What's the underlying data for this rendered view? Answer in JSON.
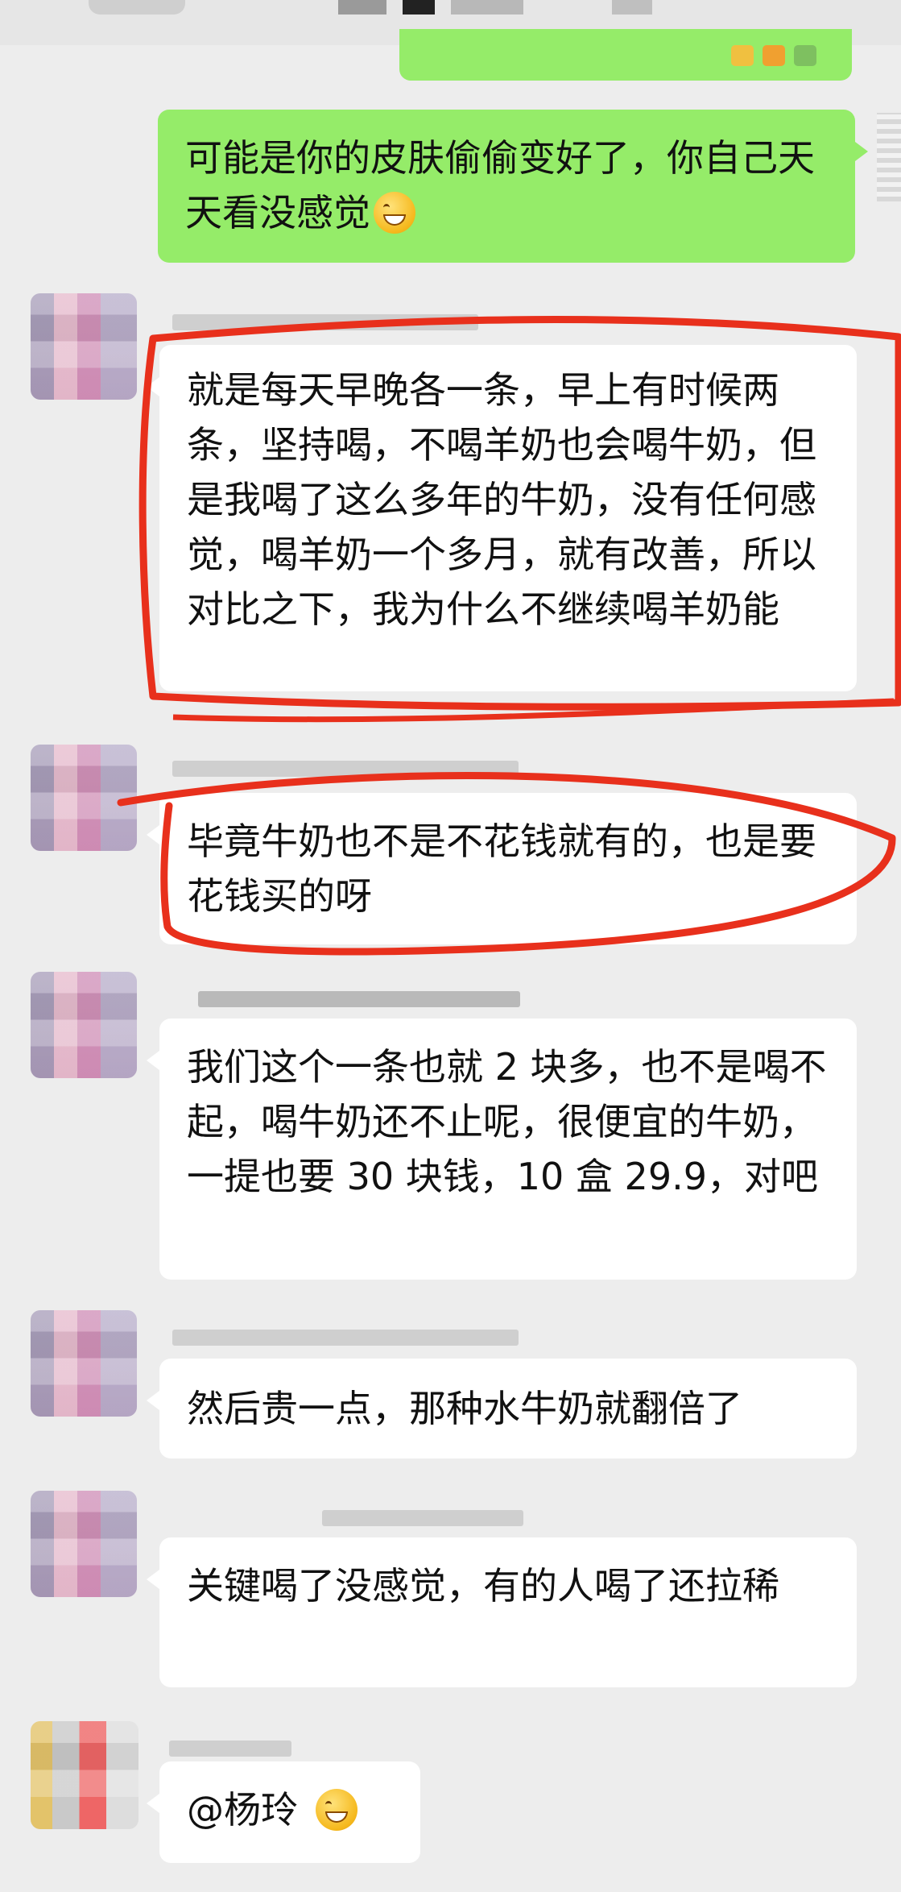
{
  "messages": [
    {
      "side": "right",
      "text": "可能是你的皮肤偷偷变好了，你自己天天看没感觉",
      "emoji": "grinning-squinting-face"
    },
    {
      "side": "left",
      "text": "就是每天早晚各一条，早上有时候两条，坚持喝，不喝羊奶也会喝牛奶，但是我喝了这么多年的牛奶，没有任何感觉，喝羊奶一个多月，就有改善，所以对比之下，我为什么不继续喝羊奶能"
    },
    {
      "side": "left",
      "text": "毕竟牛奶也不是不花钱就有的，也是要花钱买的呀"
    },
    {
      "side": "left",
      "text": "我们这个一条也就 2 块多，也不是喝不起，喝牛奶还不止呢，很便宜的牛奶，一提也要 30 块钱，10 盒 29.9，对吧"
    },
    {
      "side": "left",
      "text": "然后贵一点，那种水牛奶就翻倍了"
    },
    {
      "side": "left",
      "text": "关键喝了没感觉，有的人喝了还拉稀"
    },
    {
      "side": "left",
      "text": "@杨玲",
      "emoji": "grinning-face"
    }
  ],
  "colors": {
    "background": "#ededed",
    "self_bubble": "#95ec69",
    "other_bubble": "#ffffff",
    "annotation": "#e8301c"
  }
}
